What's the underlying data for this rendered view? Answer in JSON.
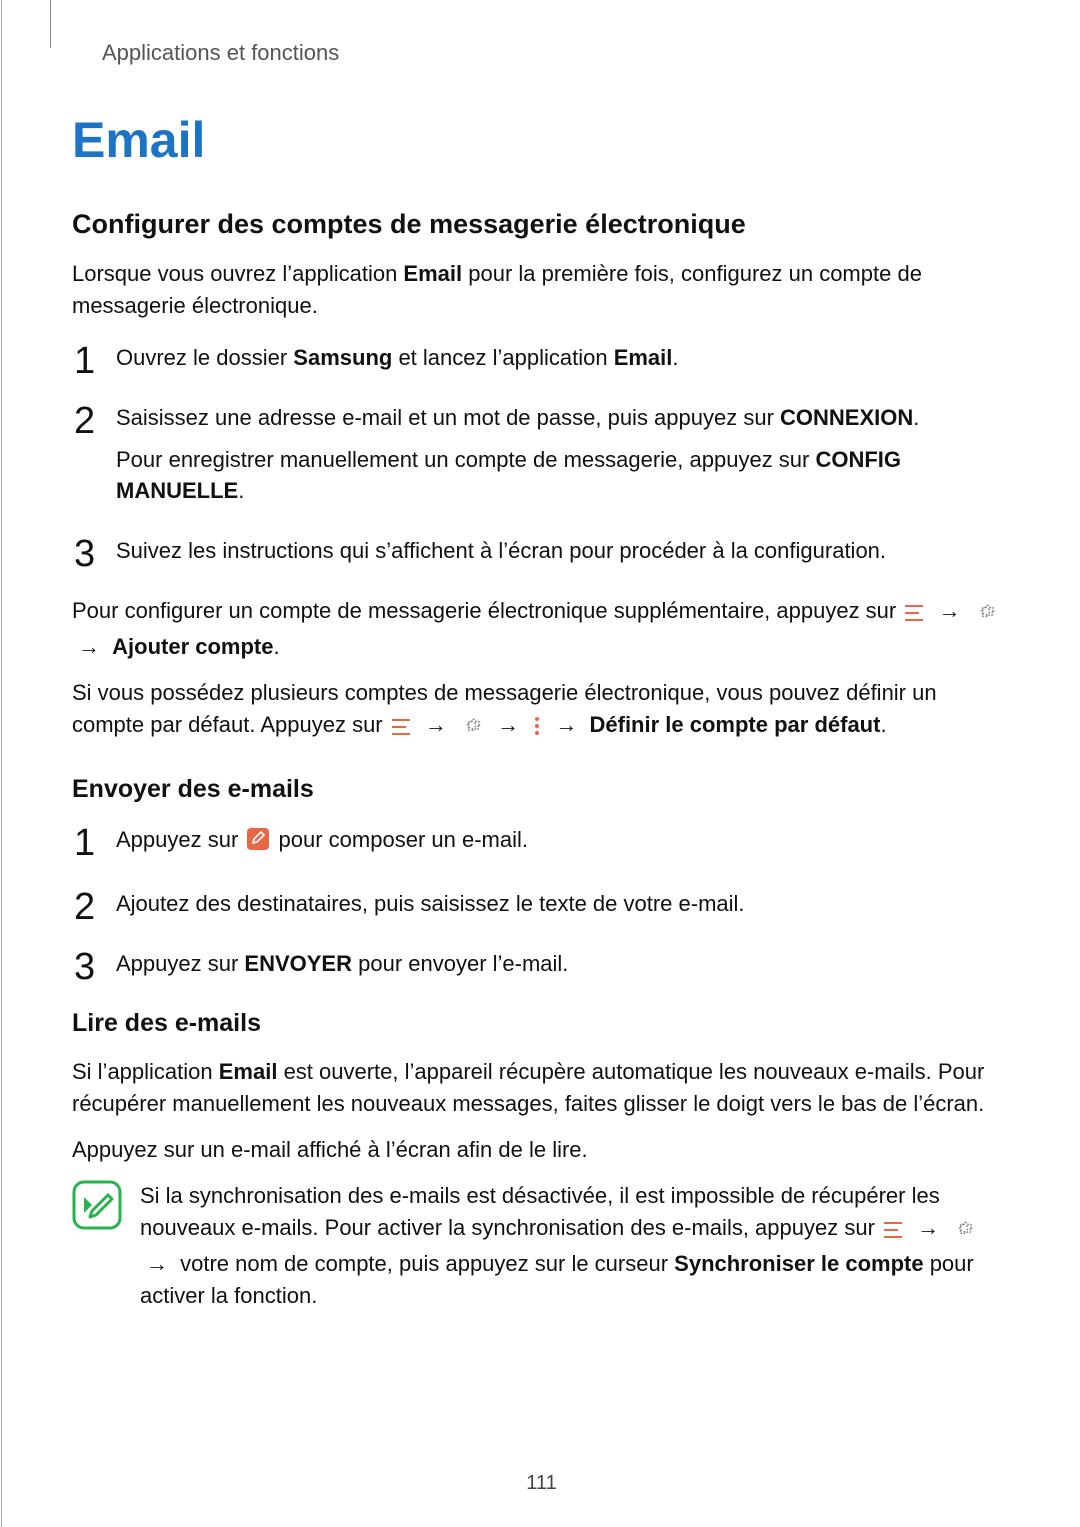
{
  "breadcrumb": "Applications et fonctions",
  "title": "Email",
  "section1": {
    "heading": "Configurer des comptes de messagerie électronique",
    "intro_a": "Lorsque vous ouvrez l’application ",
    "intro_bold": "Email",
    "intro_b": " pour la première fois, configurez un compte de messagerie électronique.",
    "step1_a": "Ouvrez le dossier ",
    "step1_b1": "Samsung",
    "step1_b": " et lancez l’application ",
    "step1_b2": "Email",
    "step1_c": ".",
    "step2_a": "Saisissez une adresse e-mail et un mot de passe, puis appuyez sur ",
    "step2_b1": "CONNEXION",
    "step2_b": ".",
    "step2_sub_a": "Pour enregistrer manuellement un compte de messagerie, appuyez sur ",
    "step2_sub_b1": "CONFIG MANUELLE",
    "step2_sub_b": ".",
    "step3": "Suivez les instructions qui s’affichent à l’écran pour procéder à la configuration.",
    "para_add_a": "Pour configurer un compte de messagerie électronique supplémentaire, appuyez sur ",
    "para_add_bold": "Ajouter compte",
    "para_add_b": ".",
    "para_default_a": "Si vous possédez plusieurs comptes de messagerie électronique, vous pouvez définir un compte par défaut. Appuyez sur ",
    "para_default_bold": "Définir le compte par défaut",
    "para_default_b": "."
  },
  "section2": {
    "heading": "Envoyer des e-mails",
    "step1_a": "Appuyez sur ",
    "step1_b": " pour composer un e-mail.",
    "step2": "Ajoutez des destinataires, puis saisissez le texte de votre e-mail.",
    "step3_a": "Appuyez sur ",
    "step3_b1": "ENVOYER",
    "step3_b": " pour envoyer l’e-mail."
  },
  "section3": {
    "heading": "Lire des e-mails",
    "para1_a": "Si l’application ",
    "para1_b1": "Email",
    "para1_b": " est ouverte, l’appareil récupère automatique les nouveaux e-mails. Pour récupérer manuellement les nouveaux messages, faites glisser le doigt vers le bas de l’écran.",
    "para2": "Appuyez sur un e-mail affiché à l’écran afin de le lire.",
    "note_a": "Si la synchronisation des e-mails est désactivée, il est impossible de récupérer les nouveaux e-mails. Pour activer la synchronisation des e-mails, appuyez sur ",
    "note_b": " votre nom de compte, puis appuyez sur le curseur ",
    "note_bold": "Synchroniser le compte",
    "note_c": " pour activer la fonction."
  },
  "page_number": "111",
  "colors": {
    "title": "#1e74c4",
    "menu_icon": "#e86846",
    "compose_icon_bg": "#e86846",
    "note_icon": "#28b24c",
    "gear_icon": "#555",
    "dots_icon": "#e86846"
  }
}
